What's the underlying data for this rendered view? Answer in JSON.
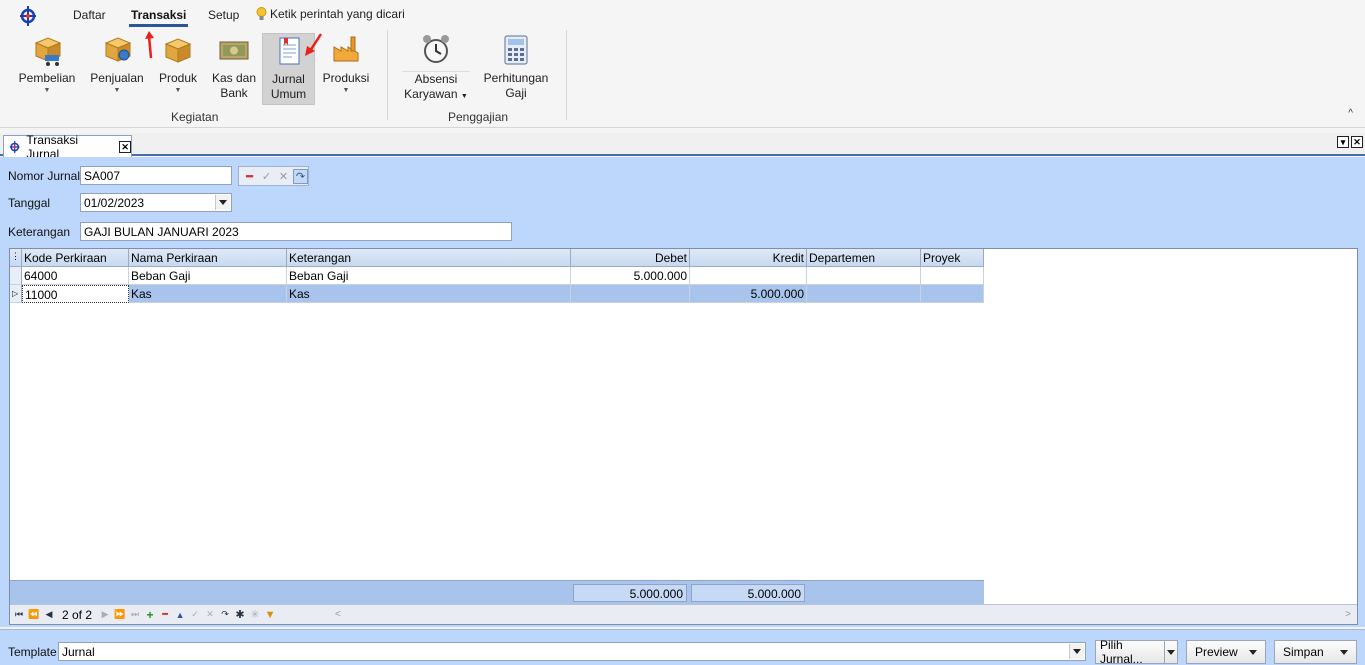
{
  "ribbon": {
    "tabs": [
      {
        "label": "Daftar"
      },
      {
        "label": "Transaksi"
      },
      {
        "label": "Setup"
      }
    ],
    "search_hint": "Ketik perintah yang dicari",
    "buttons": {
      "pembelian": "Pembelian",
      "penjualan": "Penjualan",
      "produk": "Produk",
      "kas_bank_1": "Kas dan",
      "kas_bank_2": "Bank",
      "jurnal_1": "Jurnal",
      "jurnal_2": "Umum",
      "produksi": "Produksi",
      "absensi_1": "Absensi",
      "absensi_2": "Karyawan",
      "gaji_1": "Perhitungan",
      "gaji_2": "Gaji"
    },
    "groups": {
      "kegiatan": "Kegiatan",
      "penggajian": "Penggajian"
    }
  },
  "doc_tab": {
    "title": "Transaksi Jurnal"
  },
  "form": {
    "nomor_label": "Nomor Jurnal",
    "nomor_value": "SA007",
    "tanggal_label": "Tanggal",
    "tanggal_value": "01/02/2023",
    "keterangan_label": "Keterangan",
    "keterangan_value": "GAJI BULAN JANUARI 2023"
  },
  "grid": {
    "columns": [
      "Kode Perkiraan",
      "Nama Perkiraan",
      "Keterangan",
      "Debet",
      "Kredit",
      "Departemen",
      "Proyek"
    ],
    "rows": [
      {
        "kode": "64000",
        "nama": "Beban Gaji",
        "ket": "Beban Gaji",
        "debet": "5.000.000",
        "kredit": "",
        "dept": "",
        "proyek": ""
      },
      {
        "kode": "11000",
        "nama": "Kas",
        "ket": "Kas",
        "debet": "",
        "kredit": "5.000.000",
        "dept": "",
        "proyek": ""
      }
    ],
    "total_debet": "5.000.000",
    "total_kredit": "5.000.000",
    "record_info": "2 of 2"
  },
  "bottom": {
    "template_label": "Template",
    "template_value": "Jurnal",
    "pilih_label": "Pilih Jurnal...",
    "preview_label": "Preview",
    "simpan_label": "Simpan"
  },
  "colors": {
    "accent": "#2b5797",
    "form_bg": "#bcd7fb",
    "selected_row": "#a9c4ec",
    "annotation": "#e8221b"
  }
}
